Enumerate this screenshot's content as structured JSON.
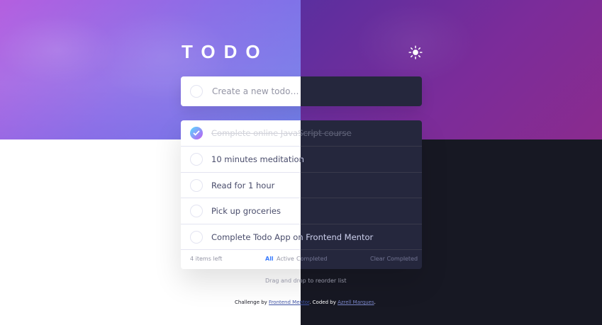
{
  "header": {
    "title": "TODO",
    "theme_icon": "sun-icon"
  },
  "new_todo": {
    "placeholder": "Create a new todo…"
  },
  "todos": [
    {
      "text": "Complete online JavaScript course",
      "completed": true
    },
    {
      "text": "10 minutes meditation",
      "completed": false
    },
    {
      "text": "Read for 1 hour",
      "completed": false
    },
    {
      "text": "Pick up groceries",
      "completed": false
    },
    {
      "text": "Complete Todo App on Frontend Mentor",
      "completed": false
    }
  ],
  "footer": {
    "items_left": "4 items left",
    "filters": {
      "all": "All",
      "active": "Active",
      "completed": "Completed"
    },
    "clear_completed": "Clear Completed"
  },
  "drag_hint": "Drag and drop to reorder list",
  "attribution": {
    "prefix": "Challenge by ",
    "frontend_mentor": "Frontend Mentor",
    "coded_by": ". Coded by ",
    "author": "Azrell Marques",
    "suffix": "."
  },
  "colors": {
    "bright_blue": "#3a7cfd",
    "check_gradient_start": "#55ddff",
    "check_gradient_end": "#c058f3",
    "light_text": "#494c6b",
    "dark_card": "#25273d",
    "dark_bg": "#171823"
  }
}
